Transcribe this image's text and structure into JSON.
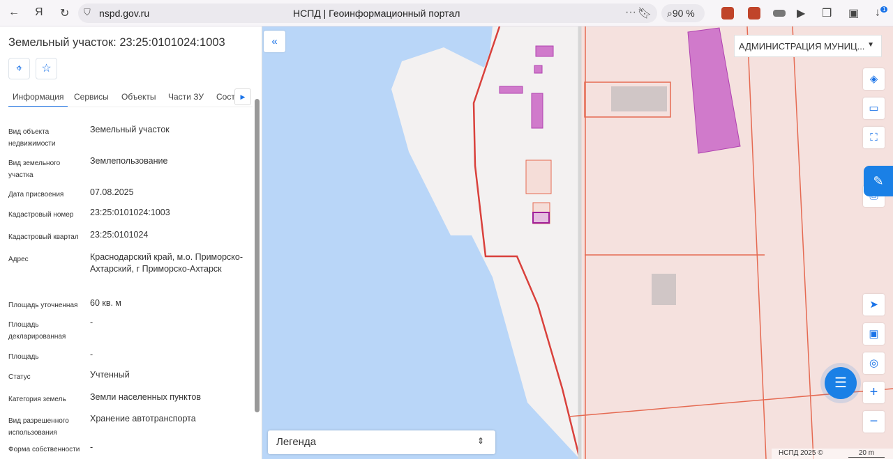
{
  "browser": {
    "url": "nspd.gov.ru",
    "title": "НСПД | Геоинформационный портал",
    "zoom": "90 %",
    "download_badge": "1"
  },
  "panel": {
    "title": "Земельный участок: 23:25:0101024:1003",
    "tabs": [
      "Информация",
      "Сервисы",
      "Объекты",
      "Части ЗУ",
      "Соста"
    ],
    "rows": [
      {
        "label": "Вид объекта недвижимости",
        "value": "Земельный участок"
      },
      {
        "label": "Вид земельного участка",
        "value": "Землепользование"
      },
      {
        "label": "Дата присвоения",
        "value": "07.08.2025"
      },
      {
        "label": "Кадастровый номер",
        "value": "23:25:0101024:1003"
      },
      {
        "label": "Кадастровый квартал",
        "value": "23:25:0101024"
      },
      {
        "label": "Адрес",
        "value": "Краснодарский край, м.о. Приморско-Ахтарский, г Приморско-Ахтарск"
      },
      {
        "label": "Площадь уточненная",
        "value": "60 кв. м"
      },
      {
        "label": "Площадь декларированная",
        "value": "-"
      },
      {
        "label": "Площадь",
        "value": "-"
      },
      {
        "label": "Статус",
        "value": "Учтенный"
      },
      {
        "label": "Категория земель",
        "value": "Земли населенных пунктов"
      },
      {
        "label": "Вид разрешенного использования",
        "value": "Хранение автотранспорта"
      },
      {
        "label": "Форма собственности",
        "value": "-"
      }
    ]
  },
  "map": {
    "owner_select": "АДМИНИСТРАЦИЯ МУНИЦ...",
    "legend": "Легенда",
    "attribution": "НСПД 2025 ©",
    "scale": "20 m"
  }
}
